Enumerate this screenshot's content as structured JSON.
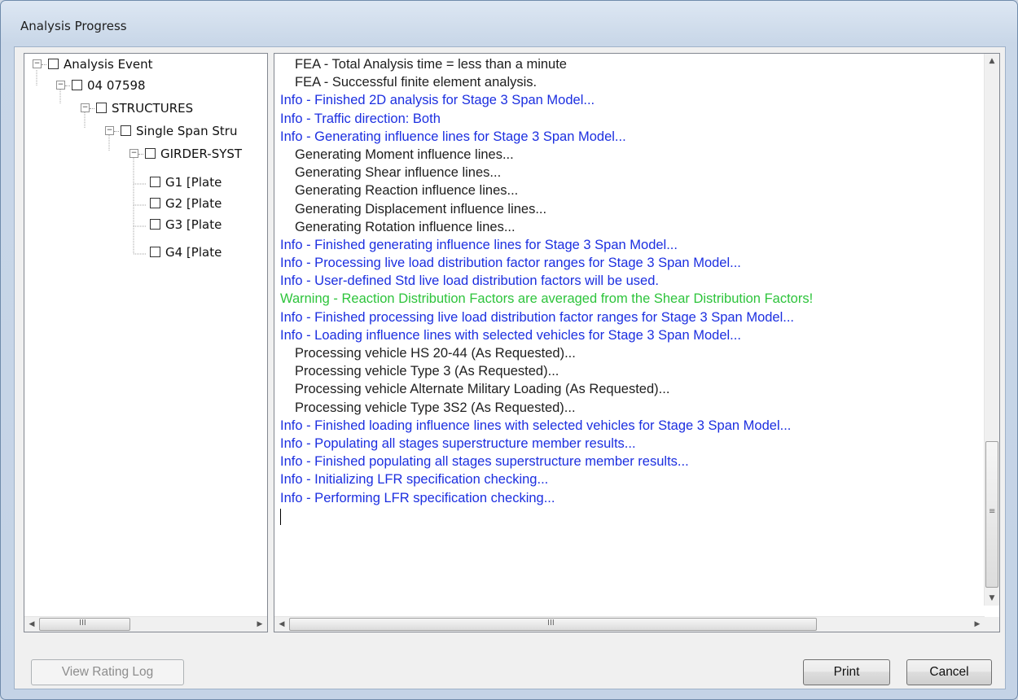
{
  "window": {
    "title": "Analysis Progress"
  },
  "tree": {
    "nodes": [
      {
        "label": "Analysis Event"
      },
      {
        "label": "04 07598"
      },
      {
        "label": "STRUCTURES"
      },
      {
        "label": "Single Span Stru"
      },
      {
        "label": "GIRDER-SYST"
      },
      {
        "label": "G1 [Plate"
      },
      {
        "label": "G2 [Plate"
      },
      {
        "label": "G3 [Plate"
      },
      {
        "label": "G4 [Plate"
      }
    ]
  },
  "log": {
    "lines": [
      {
        "type": "plain",
        "text": "FEA - Total Analysis time = less than a minute"
      },
      {
        "type": "plain",
        "text": "FEA - Successful finite element analysis."
      },
      {
        "type": "info",
        "text": "Info - Finished 2D analysis for Stage 3 Span Model..."
      },
      {
        "type": "info",
        "text": "Info - Traffic direction: Both"
      },
      {
        "type": "info",
        "text": "Info - Generating influence lines for Stage 3 Span Model..."
      },
      {
        "type": "plain",
        "text": "Generating Moment influence lines..."
      },
      {
        "type": "plain",
        "text": "Generating Shear influence lines..."
      },
      {
        "type": "plain",
        "text": "Generating Reaction influence lines..."
      },
      {
        "type": "plain",
        "text": "Generating Displacement influence lines..."
      },
      {
        "type": "plain",
        "text": "Generating Rotation influence lines..."
      },
      {
        "type": "info",
        "text": "Info - Finished generating influence lines for Stage 3 Span Model..."
      },
      {
        "type": "info",
        "text": "Info - Processing live load distribution factor ranges for Stage 3 Span Model..."
      },
      {
        "type": "info",
        "text": "Info - User-defined Std live load distribution factors will be used."
      },
      {
        "type": "warn",
        "text": "Warning - Reaction Distribution Factors are averaged from the Shear Distribution Factors!"
      },
      {
        "type": "info",
        "text": "Info - Finished processing live load distribution factor ranges for Stage 3 Span Model..."
      },
      {
        "type": "info",
        "text": "Info - Loading influence lines with selected vehicles for Stage 3 Span Model..."
      },
      {
        "type": "plain",
        "text": "Processing vehicle HS 20-44 (As Requested)..."
      },
      {
        "type": "plain",
        "text": "Processing vehicle Type 3 (As Requested)..."
      },
      {
        "type": "plain",
        "text": "Processing vehicle Alternate Military Loading (As Requested)..."
      },
      {
        "type": "plain",
        "text": "Processing vehicle Type 3S2 (As Requested)..."
      },
      {
        "type": "info",
        "text": "Info - Finished loading influence lines with selected vehicles for Stage 3 Span Model..."
      },
      {
        "type": "info",
        "text": "Info - Populating all stages superstructure member results..."
      },
      {
        "type": "info",
        "text": "Info - Finished populating all stages superstructure member results..."
      },
      {
        "type": "info",
        "text": "Info - Initializing LFR specification checking..."
      },
      {
        "type": "info",
        "text": "Info - Performing LFR specification checking..."
      }
    ]
  },
  "colors": {
    "info": "#1c2fe0",
    "warn": "#2ec43c",
    "plain": "#202020"
  },
  "buttons": {
    "view_rating_log": "View Rating Log",
    "print": "Print",
    "cancel": "Cancel"
  },
  "icons": {
    "collapse": "minus-box-icon",
    "checkbox": "checkbox-icon",
    "scroll_up": "arrow-up-icon",
    "scroll_down": "arrow-down-icon",
    "scroll_left": "arrow-left-icon",
    "scroll_right": "arrow-right-icon"
  }
}
